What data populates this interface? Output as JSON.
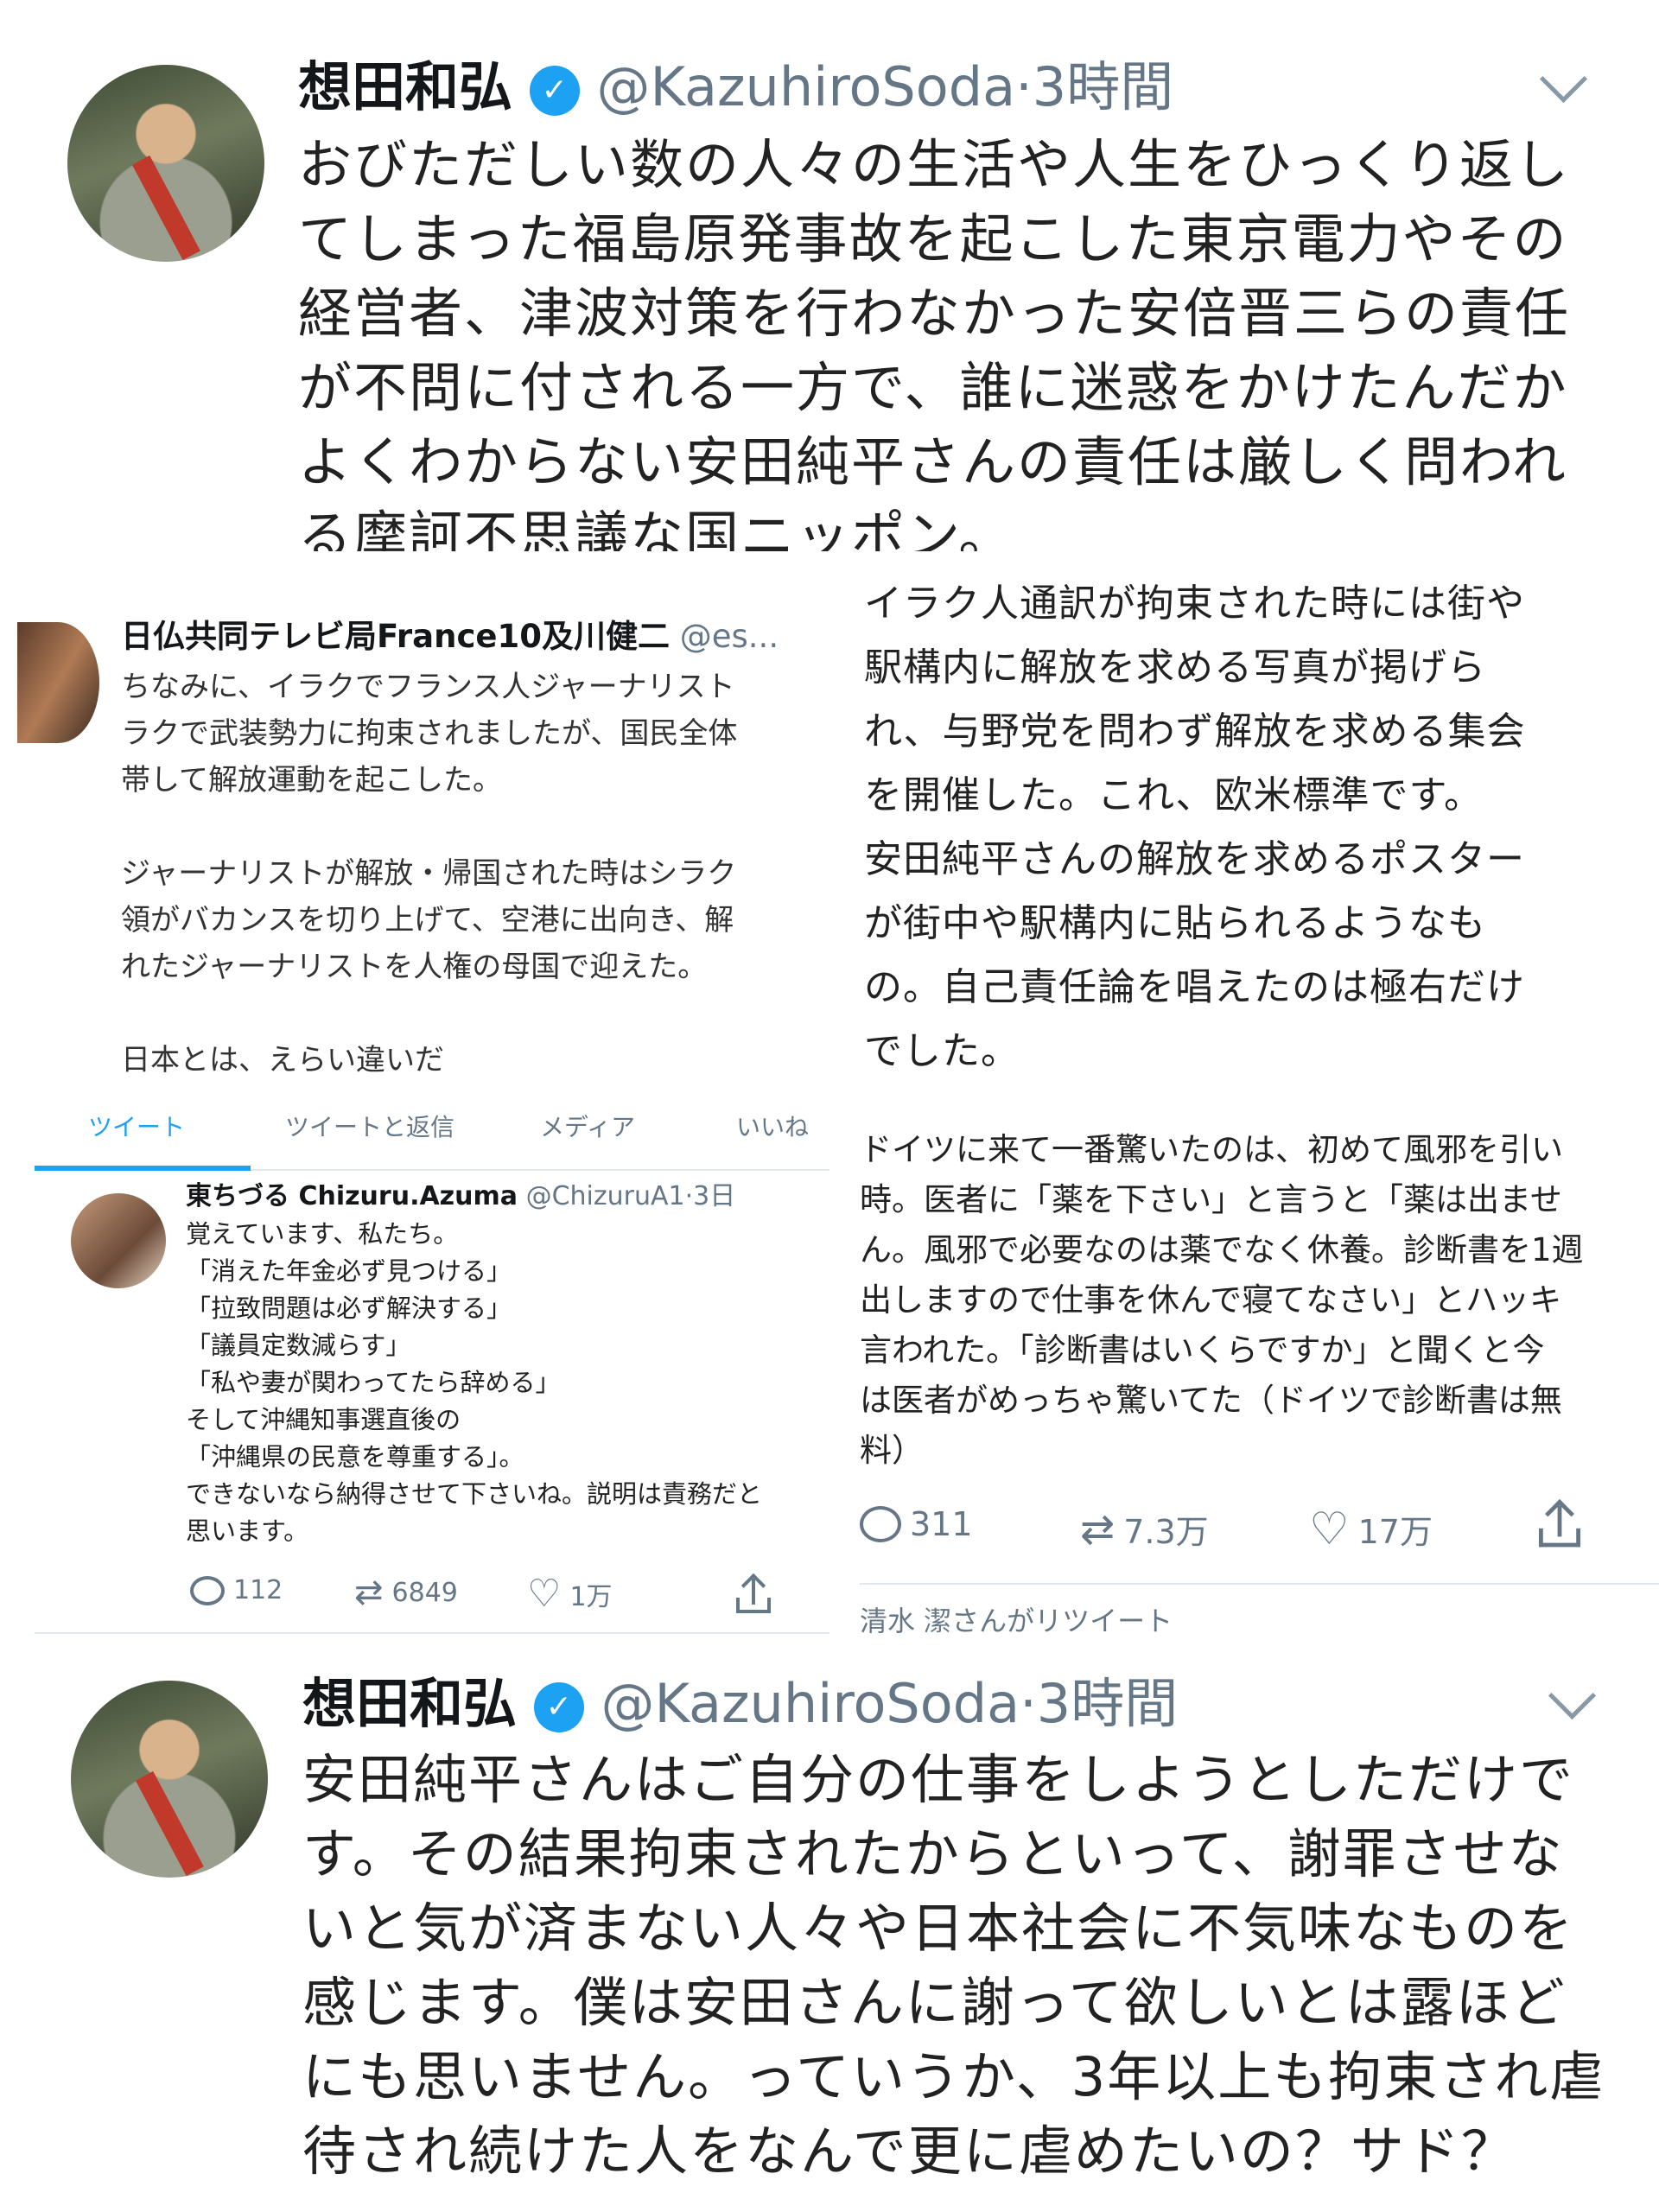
{
  "top_tweet": {
    "name": "想田和弘",
    "handle": "@KazuhiroSoda",
    "time": "·3時間",
    "lines": [
      "おびただしい数の人々の生活や人生をひっくり返し",
      "てしまった福島原発事故を起こした東京電力やその",
      "経営者、津波対策を行わなかった安倍晋三らの責任",
      "が不問に付される一方で、誰に迷惑をかけたんだか",
      "よくわからない安田純平さんの責任は厳しく問われ",
      "る摩訶不思議な国ニッポン。"
    ]
  },
  "france_tweet": {
    "name": "日仏共同テレビ局France10及川健二",
    "handle": "@es...",
    "lines": [
      "ちなみに、イラクでフランス人ジャーナリスト",
      "ラクで武装勢力に拘束されましたが、国民全体",
      "帯して解放運動を起こした。",
      "",
      "ジャーナリストが解放・帰国された時はシラク",
      "領がバカンスを切り上げて、空港に出向き、解",
      "れたジャーナリストを人権の母国で迎えた。",
      "",
      "日本とは、えらい違いだ"
    ]
  },
  "right_text": {
    "lines": [
      "イラク人通訳が拘束された時には街や",
      "駅構内に解放を求める写真が掲げら",
      "れ、与野党を問わず解放を求める集会",
      "を開催した。これ、欧米標準です。",
      "安田純平さんの解放を求めるポスター",
      "が街中や駅構内に貼られるようなも",
      "の。自己責任論を唱えたのは極右だけ",
      "でした。"
    ]
  },
  "profile_tabs": [
    "ツイート",
    "ツイートと返信",
    "メディア",
    "いいね"
  ],
  "azuma_tweet": {
    "name": "東ちづる Chizuru.Azuma",
    "handle": "@ChizuruA1",
    "time": "·3日",
    "lines": [
      "覚えています、私たち。",
      "「消えた年金必ず見つける」",
      "「拉致問題は必ず解決する」",
      "「議員定数減らす」",
      "「私や妻が関わってたら辞める」",
      "そして沖縄知事選直後の",
      "「沖縄県の民意を尊重する」。",
      "できないなら納得させて下さいね。説明は責務だと",
      "思います。"
    ],
    "replies": "112",
    "retweets": "6849",
    "likes": "1万"
  },
  "germany_tweet": {
    "lines": [
      "ドイツに来て一番驚いたのは、初めて風邪を引い",
      "時。医者に「薬を下さい」と言うと「薬は出ませ",
      "ん。風邪で必要なのは薬でなく休養。診断書を1週",
      "出しますので仕事を休んで寝てなさい」とハッキ",
      "言われた。「診断書はいくらですか」と聞くと今",
      "は医者がめっちゃ驚いてた（ドイツで診断書は無",
      "料）"
    ],
    "replies": "311",
    "retweets": "7.3万",
    "likes": "17万"
  },
  "retweet_label": "清水 潔さんがリツイート",
  "bottom_tweet": {
    "name": "想田和弘",
    "handle": "@KazuhiroSoda",
    "time": "·3時間",
    "lines": [
      "安田純平さんはご自分の仕事をしようとしただけで",
      "す。その結果拘束されたからといって、謝罪させな",
      "いと気が済まない人々や日本社会に不気味なものを",
      "感じます。僕は安田さんに謝って欲しいとは露ほど",
      "にも思いません。っていうか、3年以上も拘束され虐",
      "待され続けた人をなんで更に虐めたいの？サド？"
    ]
  },
  "colors": {
    "verified": "#1da1f2",
    "muted": "#657786",
    "tab_active": "#1da1f2"
  },
  "icons": [
    "verified-badge-icon",
    "chevron-down-icon",
    "reply-icon",
    "retweet-icon",
    "like-icon",
    "share-icon"
  ]
}
